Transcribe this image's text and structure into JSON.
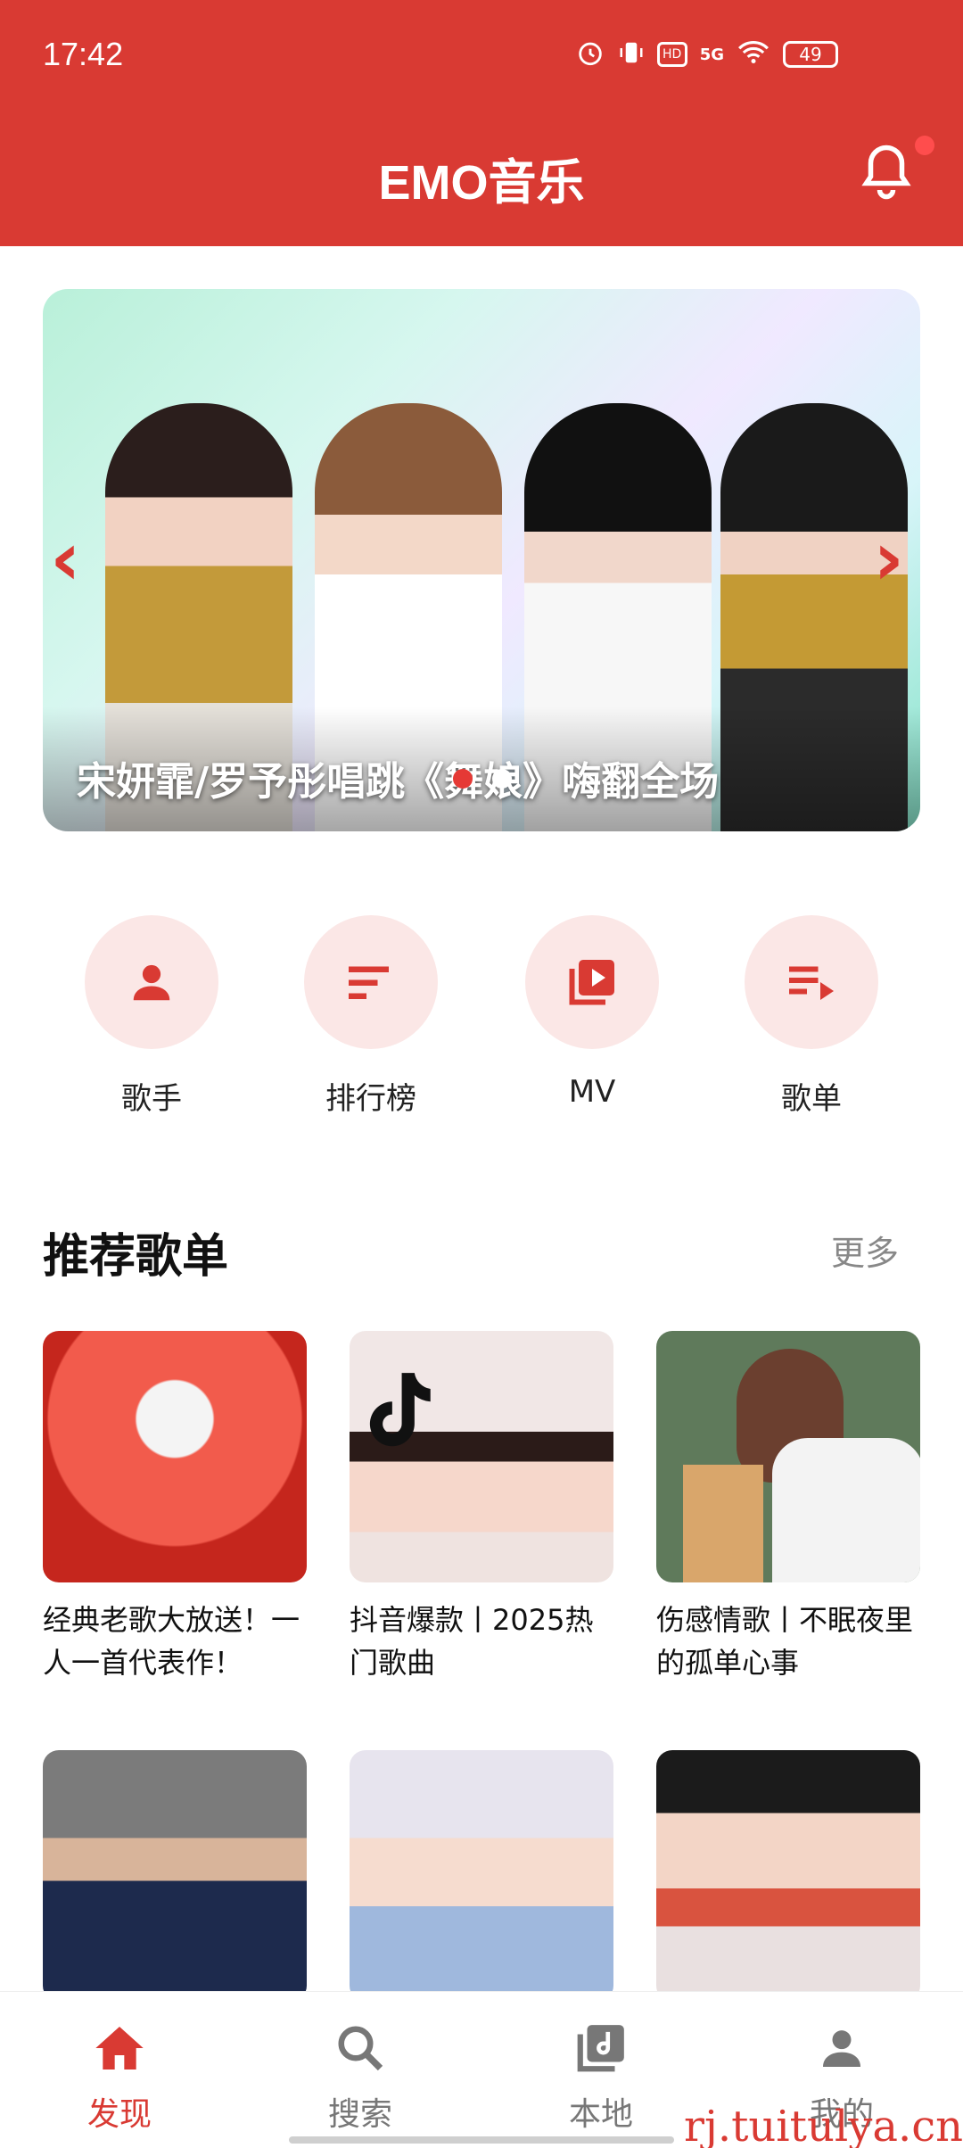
{
  "status_bar": {
    "time": "17:42",
    "battery": "49",
    "network": "5G",
    "hd": "HD"
  },
  "header": {
    "title": "EMO音乐"
  },
  "banner": {
    "caption": "宋妍霏/罗予彤唱跳《舞娘》嗨翻全场",
    "active_index": 0
  },
  "quick_entries": [
    {
      "label": "歌手",
      "icon": "person-icon"
    },
    {
      "label": "排行榜",
      "icon": "ranking-icon"
    },
    {
      "label": "MV",
      "icon": "video-library-icon"
    },
    {
      "label": "歌单",
      "icon": "playlist-icon"
    }
  ],
  "recommend": {
    "title": "推荐歌单",
    "more": "更多",
    "playlists": [
      {
        "title": "经典老歌大放送！一人一首代表作！"
      },
      {
        "title": "抖音爆款丨2025热门歌曲"
      },
      {
        "title": "伤感情歌丨不眠夜里的孤单心事"
      },
      {
        "title": ""
      },
      {
        "title": ""
      },
      {
        "title": ""
      }
    ]
  },
  "bottom_nav": [
    {
      "label": "发现",
      "icon": "home-icon",
      "active": true
    },
    {
      "label": "搜索",
      "icon": "search-icon",
      "active": false
    },
    {
      "label": "本地",
      "icon": "music-library-icon",
      "active": false
    },
    {
      "label": "我的",
      "icon": "profile-icon",
      "active": false
    }
  ],
  "watermark": "rj.tuitulya.cn",
  "colors": {
    "primary": "#d93a33",
    "accent_light": "#fbe7e6"
  }
}
